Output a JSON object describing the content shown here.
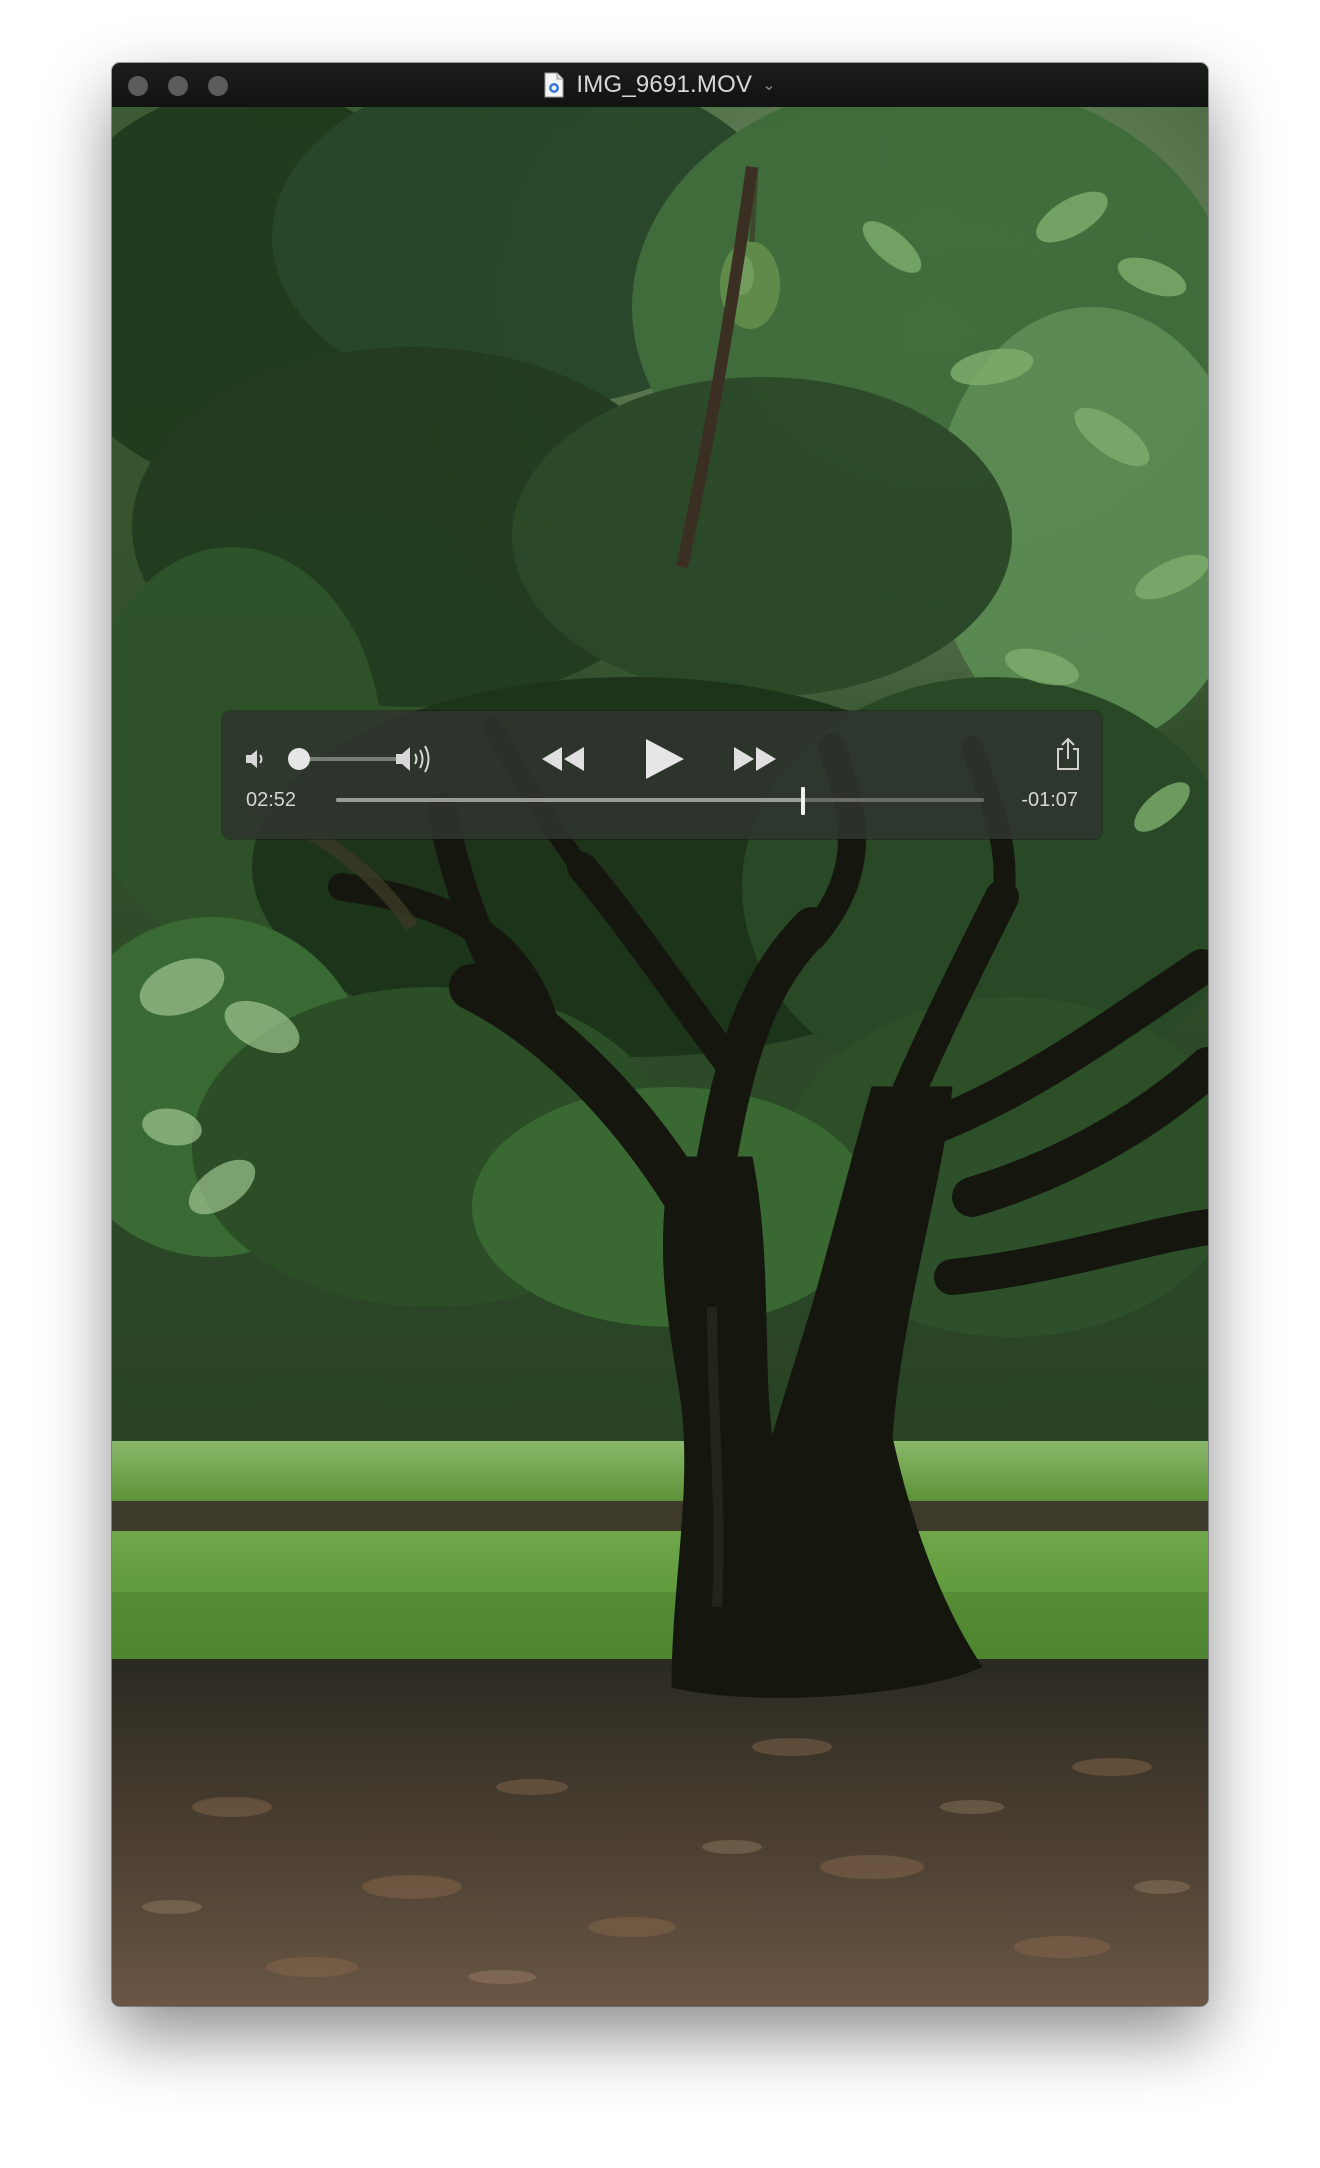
{
  "window": {
    "title": "IMG_9691.MOV"
  },
  "player": {
    "elapsed": "02:52",
    "remaining": "-01:07",
    "progress": 0.72,
    "volume": 0.0
  },
  "icons": {
    "file": "quicktime-file-icon",
    "title_menu": "chevron-down-icon",
    "volume_low": "speaker-low-icon",
    "volume_high": "speaker-high-icon",
    "rewind": "rewind-icon",
    "play": "play-icon",
    "fast_forward": "fast-forward-icon",
    "share": "share-icon"
  },
  "colors": {
    "controls_bg": "#30342e",
    "foliage": "#2f5a2b",
    "lawn": "#5f9a3d"
  }
}
